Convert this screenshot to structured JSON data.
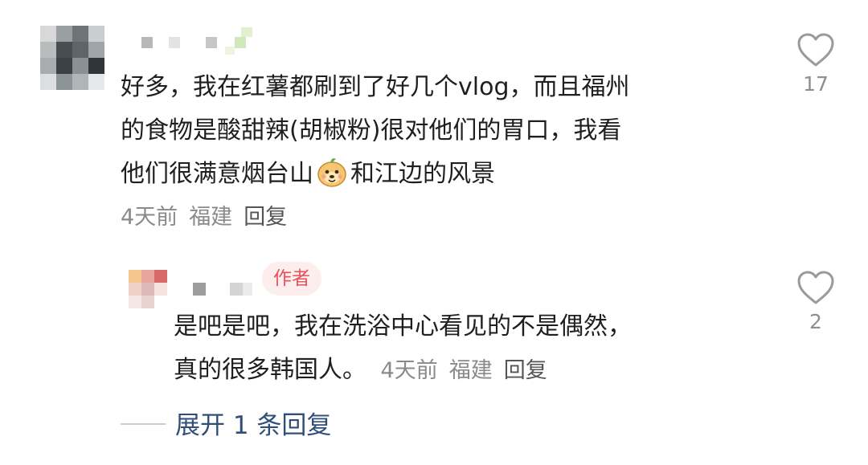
{
  "comment": {
    "text_lines": [
      "好多，我在红薯都刷到了好几个vlog，而且福州",
      "的食物是酸甜辣(胡椒粉)很对他们的胃口，我看",
      "他们很满意烟台山"
    ],
    "text_line3_tail": "和江边的风景",
    "time": "4天前",
    "location": "福建",
    "reply": "回复",
    "likes": "17"
  },
  "reply_comment": {
    "author_tag": "作者",
    "text_line1": "是吧是吧，我在洗浴中心看见的不是偶然，",
    "text_line2": "真的很多韩国人。",
    "time": "4天前",
    "location": "福建",
    "reply": "回复",
    "likes": "2"
  },
  "expand": {
    "label": "展开 1 条回复"
  },
  "icons": {
    "like": "heart-outline-icon",
    "emoji": "smiling-bun-emoji-icon"
  },
  "colors": {
    "author_tag_bg": "#fdeeee",
    "author_tag_text": "#e8505b",
    "expand_text": "#2f4f78",
    "meta_text": "#8a8a8a"
  }
}
